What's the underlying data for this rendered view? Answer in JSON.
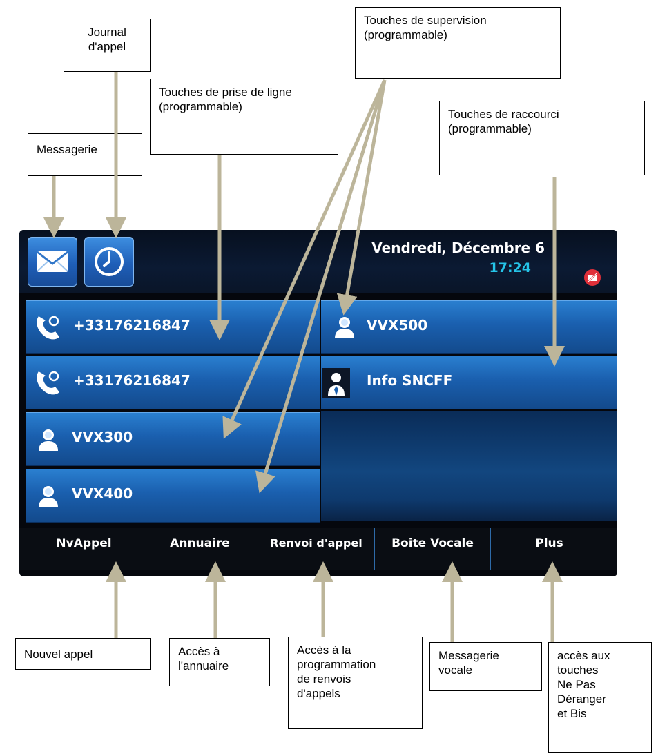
{
  "callouts": {
    "journal": "Journal\nd'appel",
    "messagerie": "Messagerie",
    "prise_ligne": "Touches de prise de ligne (programmable)",
    "supervision": "Touches de supervision (programmable)",
    "raccourci": "Touches de raccourci (programmable)",
    "nouvel_appel": "Nouvel appel",
    "annuaire": "Accès à\nl'annuaire",
    "renvoi": "Accès à la\nprogrammation\nde renvois\nd'appels",
    "boite_vocale": "Messagerie\nvocale",
    "plus": "accès aux\ntouches\nNe Pas\nDéranger\net Bis"
  },
  "phone": {
    "date": "Vendredi, Décembre 6",
    "time": "17:24",
    "line_keys": [
      {
        "label": "+33176216847",
        "icon": "phone-handset-icon"
      },
      {
        "label": "+33176216847",
        "icon": "phone-handset-icon"
      },
      {
        "label": "VVX300",
        "icon": "contact-icon"
      },
      {
        "label": "VVX400",
        "icon": "contact-icon"
      }
    ],
    "right_keys": [
      {
        "label": "VVX500",
        "icon": "contact-icon"
      },
      {
        "label": "Info SNCFF",
        "icon": "business-contact-icon"
      }
    ],
    "softkeys": [
      "NvAppel",
      "Annuaire",
      "Renvoi d'appel",
      "Boite Vocale",
      "Plus"
    ]
  },
  "colors": {
    "key_blue": "#1a5fae",
    "time_cyan": "#25c4e8",
    "arrow": "#bcb59a",
    "dnd_red": "#e0303a"
  }
}
